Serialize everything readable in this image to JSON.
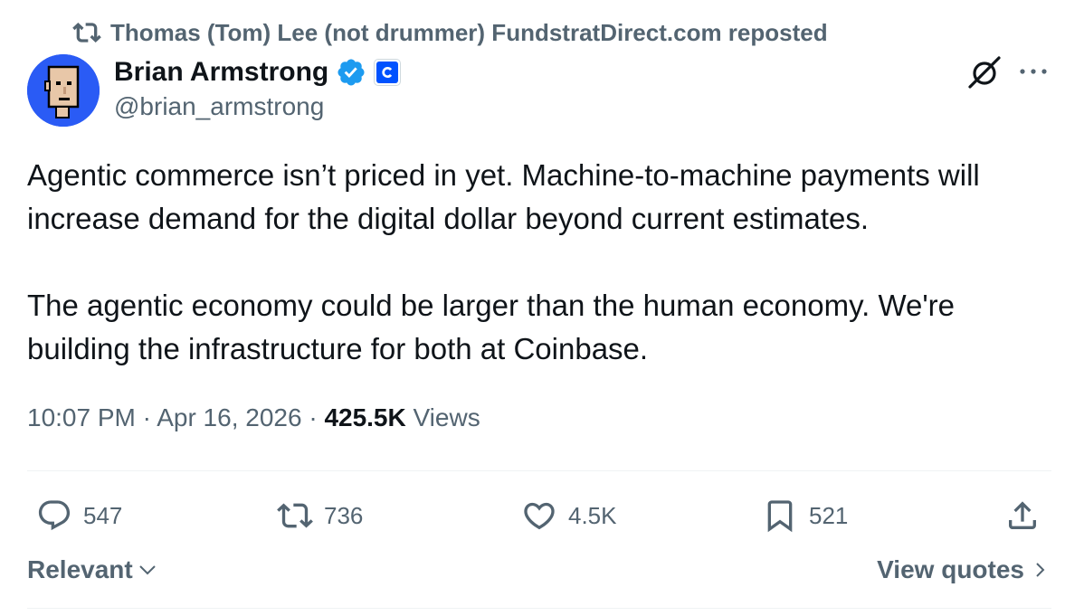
{
  "repost": {
    "text": "Thomas (Tom) Lee (not drummer) FundstratDirect.com reposted",
    "icon": "retweet-icon"
  },
  "author": {
    "name": "Brian Armstrong",
    "handle": "@brian_armstrong",
    "verified_color": "#1d9bf0",
    "affiliate_badge_color": "#0052ff",
    "affiliate_badge_letter": "C"
  },
  "tweet": {
    "paragraphs": [
      "Agentic commerce isn’t priced in yet. Machine-to-machine payments will increase demand for the digital dollar beyond current estimates.",
      "The agentic economy could be larger than the human economy. We're building the infrastructure for both at Coinbase."
    ],
    "time": "10:07 PM",
    "date": "Apr 16, 2026",
    "views_count": "425.5K",
    "views_label": "Views"
  },
  "actions": {
    "replies": "547",
    "reposts": "736",
    "likes": "4.5K",
    "bookmarks": "521"
  },
  "footer": {
    "sort_label": "Relevant",
    "view_quotes_label": "View quotes"
  },
  "colors": {
    "text": "#0f1419",
    "secondary": "#536471",
    "divider": "#eff3f4"
  }
}
